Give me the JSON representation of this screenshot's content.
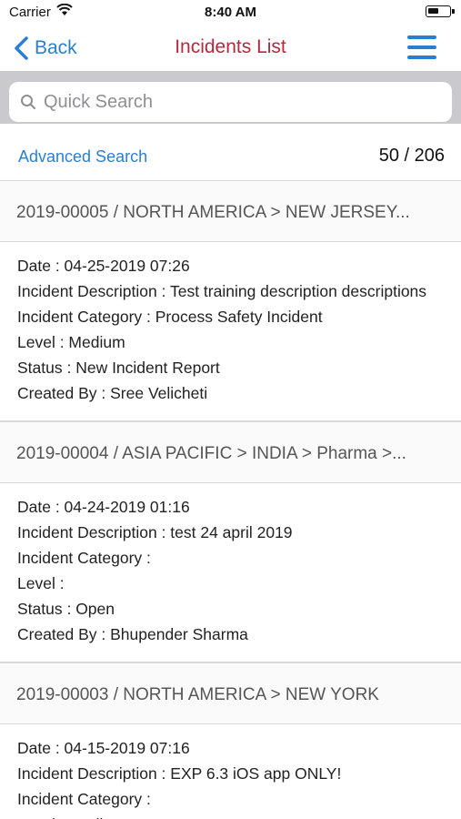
{
  "status_bar": {
    "carrier": "Carrier",
    "time": "8:40 AM"
  },
  "nav": {
    "back_label": "Back",
    "title": "Incidents List"
  },
  "search": {
    "placeholder": "Quick Search"
  },
  "filter": {
    "advanced_search_label": "Advanced Search",
    "count": "50 / 206"
  },
  "incidents": [
    {
      "header": "2019-00005 / NORTH AMERICA > NEW JERSEY...",
      "date": "Date : 04-25-2019 07:26",
      "description": "Incident Description : Test training description descriptions",
      "category": "Incident Category : Process Safety Incident",
      "level": "Level : Medium",
      "status": "Status : New Incident Report",
      "created_by": "Created By : Sree Velicheti"
    },
    {
      "header": "2019-00004 / ASIA PACIFIC > INDIA > Pharma >...",
      "date": "Date : 04-24-2019 01:16",
      "description": "Incident Description : test 24 april 2019",
      "category": "Incident Category :",
      "level": "Level :",
      "status": "Status : Open",
      "created_by": "Created By : Bhupender Sharma"
    },
    {
      "header": "2019-00003 / NORTH AMERICA > NEW YORK",
      "date": "Date : 04-15-2019 07:16",
      "description": "Incident Description : EXP 6.3 iOS app ONLY!",
      "category": "Incident Category :",
      "level": "Level : Medium"
    }
  ],
  "colors": {
    "accent": "#2b7fd1",
    "title": "#b3293e",
    "search_bg": "#c9c9ce"
  }
}
